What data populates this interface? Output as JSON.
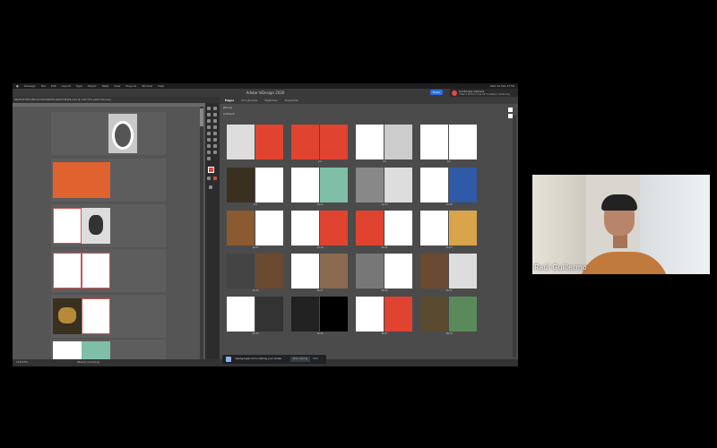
{
  "menubar": {
    "items": [
      "InDesign",
      "File",
      "Edit",
      "Layout",
      "Type",
      "Object",
      "Table",
      "View",
      "Plug-ins",
      "Window",
      "Help"
    ],
    "clock": "Wed 10 Feb 17:59"
  },
  "app": {
    "title": "Adobe InDesign 2020",
    "share_label": "Share",
    "document_tab": "PROTOTYPE-CPM-16-DISTANCES-DRAFT-MAIN.indd @ 118.33% [GPU Preview]"
  },
  "notification": {
    "title": "Continuity Camera",
    "subtitle": "\"Raul's iPhone\" has 20 % battery remaining."
  },
  "pages_panel": {
    "tabs": [
      "Pages",
      "CC Libraries",
      "Swatches",
      "Properties"
    ],
    "active_tab": "Pages",
    "none_label": "[None]",
    "parent_label": "A-Parent",
    "page_labels": [
      "",
      "2-3",
      "4-5",
      "6-7",
      "8-9",
      "10-11",
      "12-13",
      "14-15",
      "16-17",
      "18-19",
      "20-21",
      "22-23",
      "24-25",
      "26-27",
      "28-29",
      "30-31",
      "32-33",
      "34-35",
      "36-37",
      "38-39"
    ]
  },
  "status": {
    "zoom": "118.33%",
    "preset": "[Basic] (working)"
  },
  "meet_toast": {
    "message": "meet.google.com is sharing your screen.",
    "stop_label": "Stop sharing",
    "hide_label": "Hide"
  },
  "webcam": {
    "participant_name": "Raúl Guillermo"
  },
  "colors": {
    "accent_red": "#e0432f",
    "orange_spread": "#e0622e",
    "share_blue": "#2d6fe3"
  }
}
